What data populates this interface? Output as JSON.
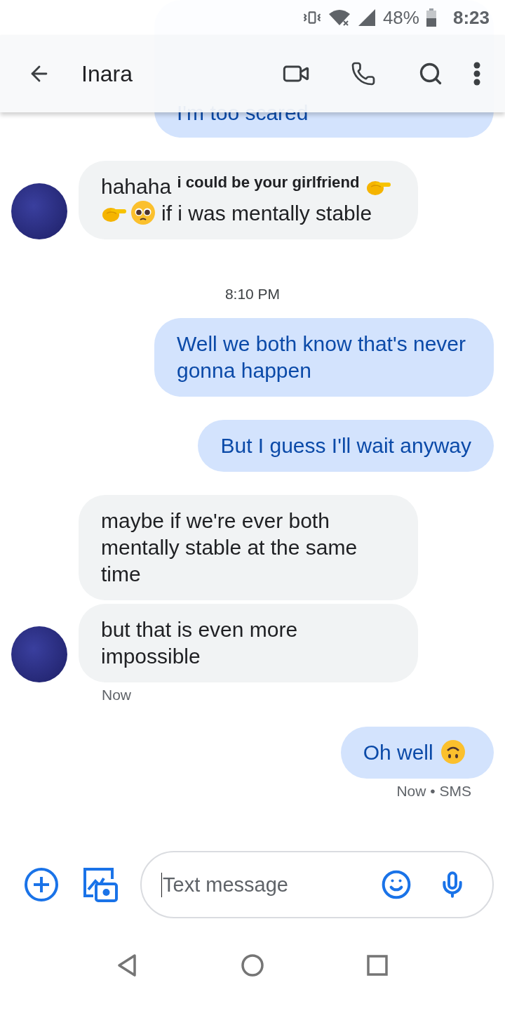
{
  "status_bar": {
    "battery": "48%",
    "time": "8:23"
  },
  "header": {
    "title": "Inara"
  },
  "conversation": [
    {
      "kind": "sent",
      "paragraphs": [
        [
          {
            "kind": "text",
            "text": "I'm too scared"
          }
        ]
      ]
    },
    {
      "kind": "received",
      "show_avatar": true,
      "paragraphs": [
        [
          {
            "kind": "text",
            "text": "hahaha $^{i could be your girlfriend}$"
          },
          {
            "kind": "pointing-hand"
          },
          {
            "kind": "pointing-hand"
          },
          {
            "kind": "pleading-face"
          },
          {
            "kind": "text",
            "text": "if i was mentally stable"
          }
        ]
      ]
    },
    {
      "kind": "timestamp",
      "text": "8:10 PM"
    },
    {
      "kind": "sent",
      "paragraphs": [
        [
          {
            "kind": "text",
            "text": "Well we both know that's never gonna happen"
          }
        ]
      ]
    },
    {
      "kind": "sent",
      "paragraphs": [
        [
          {
            "kind": "text",
            "text": "But I guess I'll wait anyway"
          }
        ]
      ]
    },
    {
      "kind": "received",
      "show_avatar": false,
      "paragraphs": [
        [
          {
            "kind": "text",
            "text": "maybe if we're ever both mentally stable at the same time"
          }
        ]
      ]
    },
    {
      "kind": "received",
      "show_avatar": true,
      "paragraphs": [
        [
          {
            "kind": "text",
            "text": "but that is even more impossible"
          }
        ]
      ]
    },
    {
      "kind": "received-note",
      "text": "Now"
    },
    {
      "kind": "sent",
      "paragraphs": [
        [
          {
            "kind": "text",
            "text": "Oh well"
          },
          {
            "kind": "upside-down-face"
          }
        ]
      ]
    },
    {
      "kind": "sent-note",
      "text": "Now • SMS"
    }
  ],
  "compose": {
    "placeholder": "Text message"
  }
}
